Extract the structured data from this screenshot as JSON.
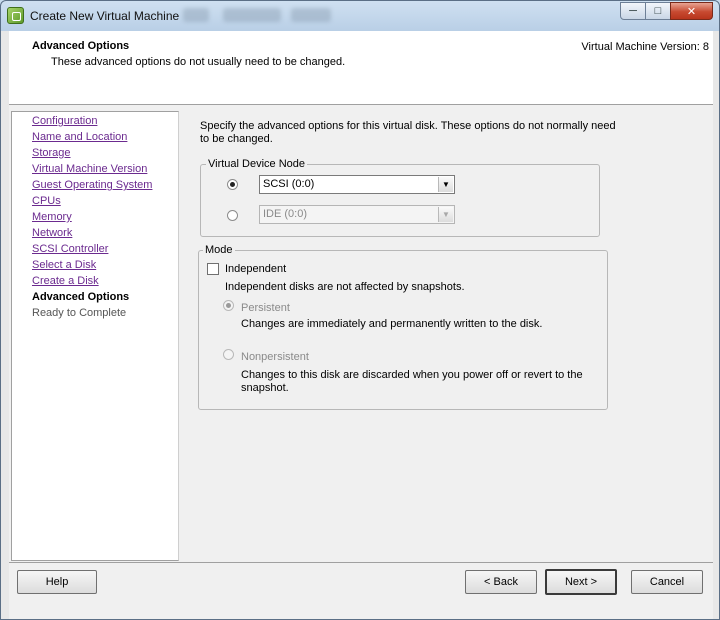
{
  "window": {
    "title": "Create New Virtual Machine",
    "minimize_icon": "minimize-icon",
    "maximize_icon": "maximize-icon",
    "close_icon": "close-icon"
  },
  "header": {
    "title": "Advanced Options",
    "subtitle": "These advanced options do not usually need to be changed.",
    "version": "Virtual Machine Version: 8"
  },
  "nav": {
    "items": [
      {
        "label": "Configuration",
        "state": "link"
      },
      {
        "label": "Name and Location",
        "state": "link"
      },
      {
        "label": "Storage",
        "state": "link"
      },
      {
        "label": "Virtual Machine Version",
        "state": "link"
      },
      {
        "label": "Guest Operating System",
        "state": "link"
      },
      {
        "label": "CPUs",
        "state": "link"
      },
      {
        "label": "Memory",
        "state": "link"
      },
      {
        "label": "Network",
        "state": "link"
      },
      {
        "label": "SCSI Controller",
        "state": "link"
      },
      {
        "label": "Select a Disk",
        "state": "link"
      },
      {
        "label": "Create a Disk",
        "state": "link"
      },
      {
        "label": "Advanced Options",
        "state": "current"
      },
      {
        "label": "Ready to Complete",
        "state": "disabled"
      }
    ]
  },
  "main": {
    "description": "Specify the advanced options for this virtual disk. These options do not normally need to be changed.",
    "device_node": {
      "legend": "Virtual Device Node",
      "scsi_value": "SCSI (0:0)",
      "ide_value": "IDE (0:0)",
      "selected": "scsi"
    },
    "mode": {
      "legend": "Mode",
      "independent_label": "Independent",
      "independent_checked": false,
      "independent_note": "Independent disks are not affected by snapshots.",
      "persistent_label": "Persistent",
      "persistent_desc": "Changes are immediately and permanently written to the disk.",
      "nonpersistent_label": "Nonpersistent",
      "nonpersistent_desc_1": "Changes to this disk are discarded when you power off or revert to the",
      "nonpersistent_desc_2": "snapshot."
    }
  },
  "footer": {
    "help": "Help",
    "back": "< Back",
    "next": "Next >",
    "cancel": "Cancel"
  },
  "colors": {
    "link": "#6b2a8f",
    "close_button": "#c74a31",
    "title_bar": "#b9cfe6"
  }
}
